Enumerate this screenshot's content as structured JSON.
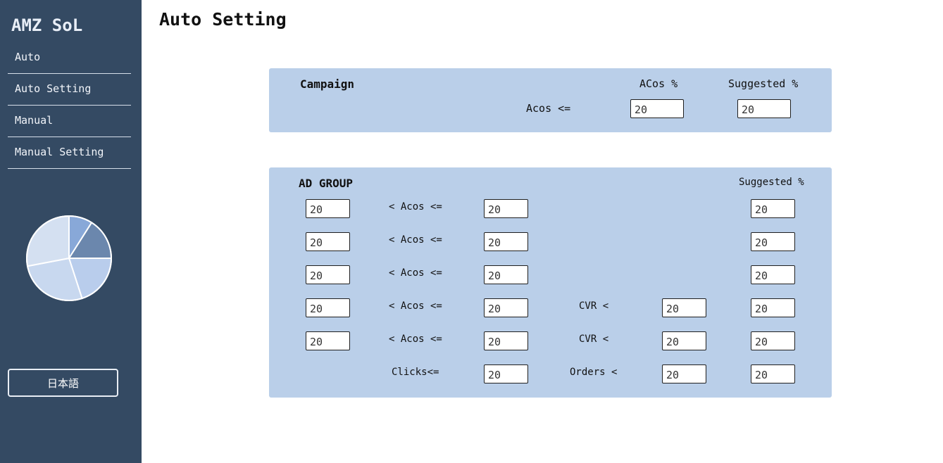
{
  "sidebar": {
    "brand": "AMZ SoL",
    "items": [
      {
        "label": "Auto"
      },
      {
        "label": "Auto Setting"
      },
      {
        "label": "Manual"
      },
      {
        "label": "Manual Setting"
      }
    ],
    "language_button": "日本語"
  },
  "page": {
    "title": "Auto Setting"
  },
  "campaign": {
    "title": "Campaign",
    "col_acos": "ACos %",
    "col_suggested": "Suggested %",
    "row_label": "Acos <=",
    "acos_value": "20",
    "suggested_value": "20"
  },
  "ad_group": {
    "title": "AD GROUP",
    "col_suggested": "Suggested %",
    "rows": [
      {
        "min": "20",
        "op": "< Acos <=",
        "max": "20",
        "suggested": "20"
      },
      {
        "min": "20",
        "op": "< Acos <=",
        "max": "20",
        "suggested": "20"
      },
      {
        "min": "20",
        "op": "< Acos <=",
        "max": "20",
        "suggested": "20"
      },
      {
        "min": "20",
        "op": "< Acos <=",
        "max": "20",
        "extra_label": "CVR <",
        "extra": "20",
        "suggested": "20"
      },
      {
        "min": "20",
        "op": "< Acos <=",
        "max": "20",
        "extra_label": "CVR <",
        "extra": "20",
        "suggested": "20"
      }
    ],
    "last_row": {
      "clicks_label": "Clicks<=",
      "clicks": "20",
      "orders_label": "Orders <",
      "orders": "20",
      "suggested": "20"
    }
  },
  "pie": {
    "slices": [
      {
        "value": 9,
        "color": "#88a8d8"
      },
      {
        "value": 16,
        "color": "#6b87ad"
      },
      {
        "value": 20,
        "color": "#b9cdec"
      },
      {
        "value": 27,
        "color": "#c8d8ef"
      },
      {
        "value": 28,
        "color": "#d4e0f1"
      }
    ]
  }
}
